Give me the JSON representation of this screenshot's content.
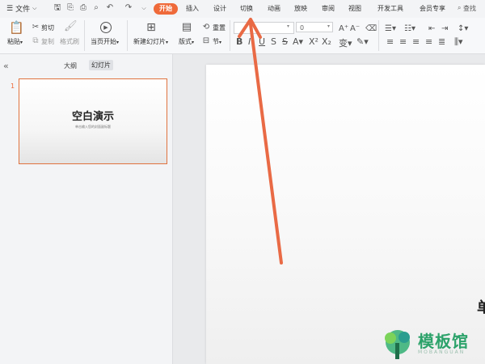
{
  "menubar": {
    "file": "文件",
    "tabs": [
      "开始",
      "插入",
      "设计",
      "切换",
      "动画",
      "放映",
      "审阅",
      "视图",
      "开发工具",
      "会员专享"
    ],
    "active_tab": "开始",
    "search": "查找"
  },
  "ribbon": {
    "paste": "粘贴",
    "cut": "剪切",
    "copy": "复制",
    "format_painter": "格式刷",
    "from_start": "当页开始",
    "new_slide": "新建幻灯片",
    "layout": "版式",
    "reset": "重置",
    "section": "节",
    "font_size": "0"
  },
  "left_panel": {
    "tabs": [
      "大纲",
      "幻灯片"
    ],
    "active_tab": "幻灯片",
    "slide_number": "1",
    "thumb_title": "空白演示",
    "thumb_subtitle": "单击输入您的封面副标题"
  },
  "canvas": {
    "edge_text": "单"
  },
  "watermark": {
    "text": "模板馆",
    "sub": "MOBANGUAN"
  },
  "colors": {
    "accent": "#ef6a3a",
    "arrow": "#e96a45",
    "watermark": "#2ca26a"
  }
}
